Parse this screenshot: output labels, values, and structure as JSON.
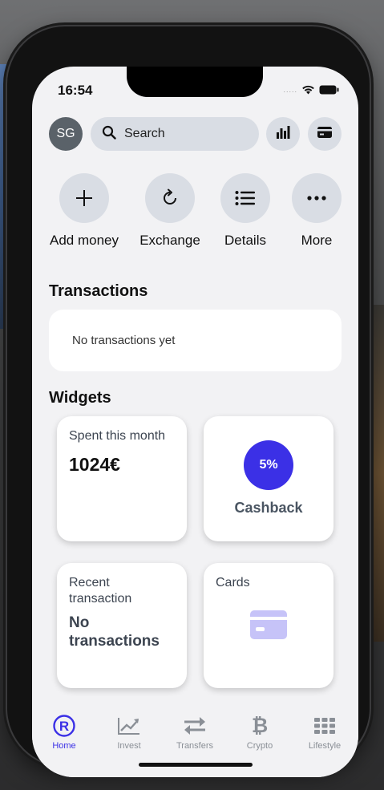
{
  "status_bar": {
    "time": "16:54",
    "signal": "....."
  },
  "header": {
    "avatar_initials": "SG",
    "search_placeholder": "Search",
    "icons": [
      "search-icon",
      "analytics-icon",
      "card-icon"
    ]
  },
  "quick_actions": [
    {
      "label": "Add money",
      "icon": "plus-icon"
    },
    {
      "label": "Exchange",
      "icon": "refresh-icon"
    },
    {
      "label": "Details",
      "icon": "list-icon"
    },
    {
      "label": "More",
      "icon": "more-icon"
    }
  ],
  "transactions": {
    "title": "Transactions",
    "empty_text": "No transactions yet"
  },
  "widgets": {
    "title": "Widgets",
    "spent": {
      "label": "Spent this month",
      "value": "1024€"
    },
    "cashback": {
      "percent": "5%",
      "label": "Cashback"
    },
    "recent": {
      "label": "Recent transaction",
      "value": "No transactions"
    },
    "cards": {
      "label": "Cards"
    }
  },
  "tabbar": {
    "items": [
      {
        "label": "Home",
        "icon": "home-r-icon",
        "active": true
      },
      {
        "label": "Invest",
        "icon": "chart-icon",
        "active": false
      },
      {
        "label": "Transfers",
        "icon": "transfer-icon",
        "active": false
      },
      {
        "label": "Crypto",
        "icon": "bitcoin-icon",
        "active": false
      },
      {
        "label": "Lifestyle",
        "icon": "grid-icon",
        "active": false
      }
    ]
  },
  "colors": {
    "accent": "#3b30e6",
    "chip_bg": "#d9dde4",
    "screen_bg": "#f2f2f4",
    "card_icon": "#c6c3f8"
  }
}
